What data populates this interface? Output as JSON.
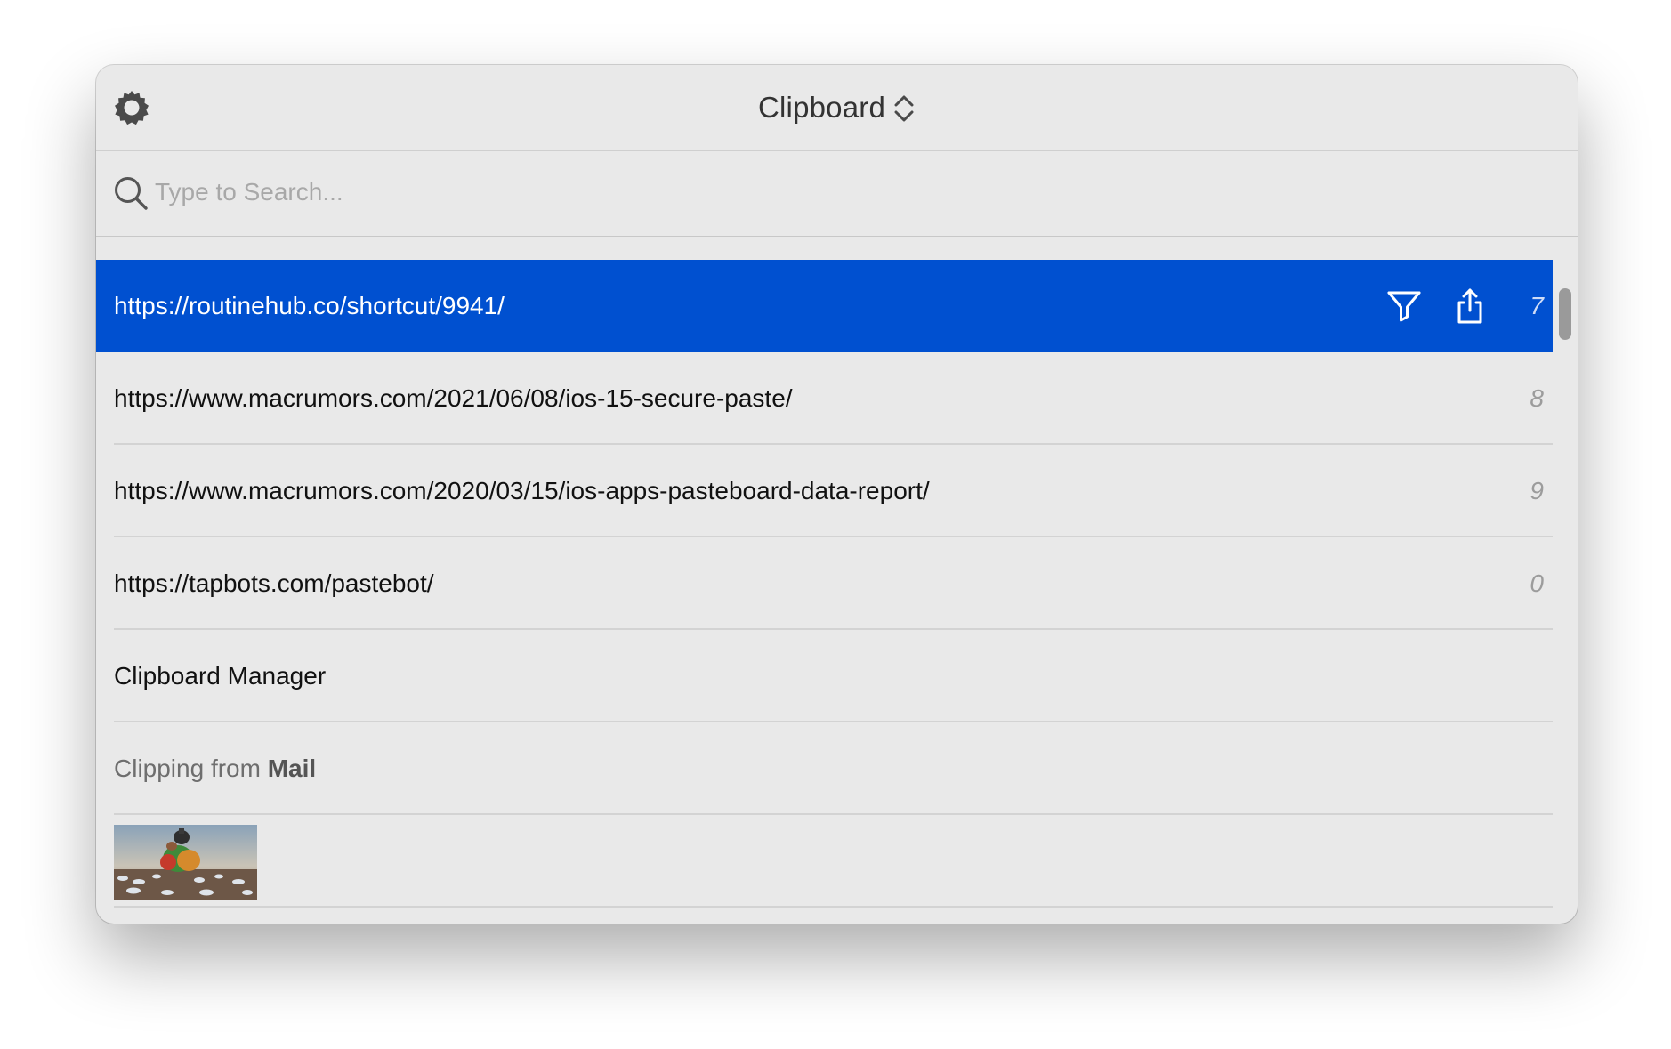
{
  "header": {
    "title": "Clipboard",
    "settings_icon": "gear-icon",
    "switcher_icon": "chevron-up-down-icon"
  },
  "search": {
    "placeholder": "Type to Search...",
    "value": "",
    "icon": "search-icon"
  },
  "colors": {
    "selection": "#0050d0",
    "window_bg": "#e9e9e9"
  },
  "items": [
    {
      "text": "https://routinehub.co/shortcut/9941/",
      "shortcut": "7",
      "selected": true,
      "actions": [
        "filter-icon",
        "share-icon"
      ]
    },
    {
      "text": "https://www.macrumors.com/2021/06/08/ios-15-secure-paste/",
      "shortcut": "8"
    },
    {
      "text": "https://www.macrumors.com/2020/03/15/ios-apps-pasteboard-data-report/",
      "shortcut": "9"
    },
    {
      "text": "https://tapbots.com/pastebot/",
      "shortcut": "0"
    },
    {
      "text": "Clipboard Manager"
    },
    {
      "prefix": "Clipping from ",
      "source": "Mail"
    },
    {
      "type": "image",
      "alt": "photo thumbnail"
    }
  ]
}
